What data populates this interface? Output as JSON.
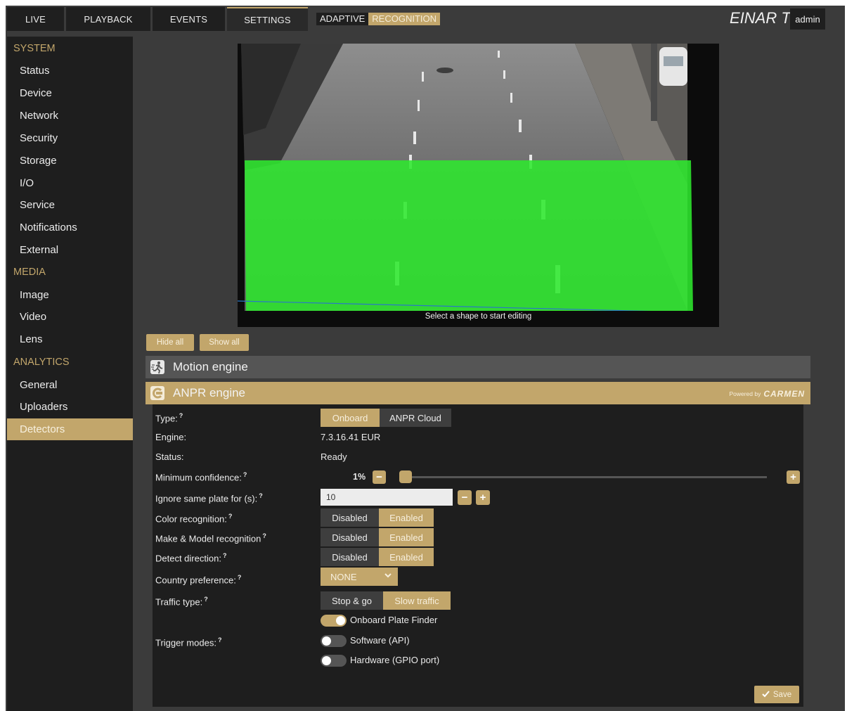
{
  "topbar": {
    "tabs": [
      "LIVE",
      "PLAYBACK",
      "EVENTS",
      "SETTINGS"
    ],
    "active_tab": "SETTINGS",
    "adaptive_part1": "ADAPTIVE",
    "adaptive_part2": "RECOGNITION",
    "device_name": "EINAR T",
    "user": "admin"
  },
  "sidebar": {
    "system_header": "SYSTEM",
    "system_items": [
      "Status",
      "Device",
      "Network",
      "Security",
      "Storage",
      "I/O",
      "Service",
      "Notifications",
      "External"
    ],
    "media_header": "MEDIA",
    "media_items": [
      "Image",
      "Video",
      "Lens"
    ],
    "analytics_header": "ANALYTICS",
    "analytics_items": [
      "General",
      "Uploaders",
      "Detectors"
    ],
    "active_item": "Detectors"
  },
  "video": {
    "caption": "Select a shape to start editing"
  },
  "shape_buttons": {
    "hide_all": "Hide all",
    "show_all": "Show all"
  },
  "motion_engine": {
    "title": "Motion engine",
    "icon": "running-person-icon"
  },
  "anpr_engine": {
    "title": "ANPR engine",
    "icon": "carmen-logo-icon",
    "powered_by": "Powered by",
    "brand": "CARMEN",
    "type_label": "Type:",
    "type_options": [
      "Onboard",
      "ANPR Cloud"
    ],
    "type_selected": "Onboard",
    "engine_label": "Engine:",
    "engine_value": "7.3.16.41 EUR",
    "status_label": "Status:",
    "status_value": "Ready",
    "min_conf_label": "Minimum confidence:",
    "min_conf_value": "1%",
    "min_conf_fraction": 0.01,
    "ignore_label": "Ignore same plate for (s):",
    "ignore_value": "10",
    "color_label": "Color recognition:",
    "make_label": "Make & Model recognition",
    "direction_label": "Detect direction:",
    "disabled_text": "Disabled",
    "enabled_text": "Enabled",
    "color_state": "Enabled",
    "make_state": "Enabled",
    "direction_state": "Enabled",
    "country_label": "Country preference:",
    "country_value": "NONE",
    "traffic_label": "Traffic type:",
    "traffic_options": [
      "Stop & go",
      "Slow traffic"
    ],
    "traffic_selected": "Slow traffic",
    "plate_finder_label": "Onboard Plate Finder",
    "plate_finder_on": true,
    "trigger_label": "Trigger modes:",
    "software_label": "Software (API)",
    "software_on": false,
    "hardware_label": "Hardware (GPIO port)",
    "hardware_on": false,
    "help_mark": "?",
    "save_label": "Save"
  },
  "colors": {
    "accent": "#c2a66b",
    "zone": "#2ee82e",
    "panel_dark": "#1e1e1e"
  }
}
